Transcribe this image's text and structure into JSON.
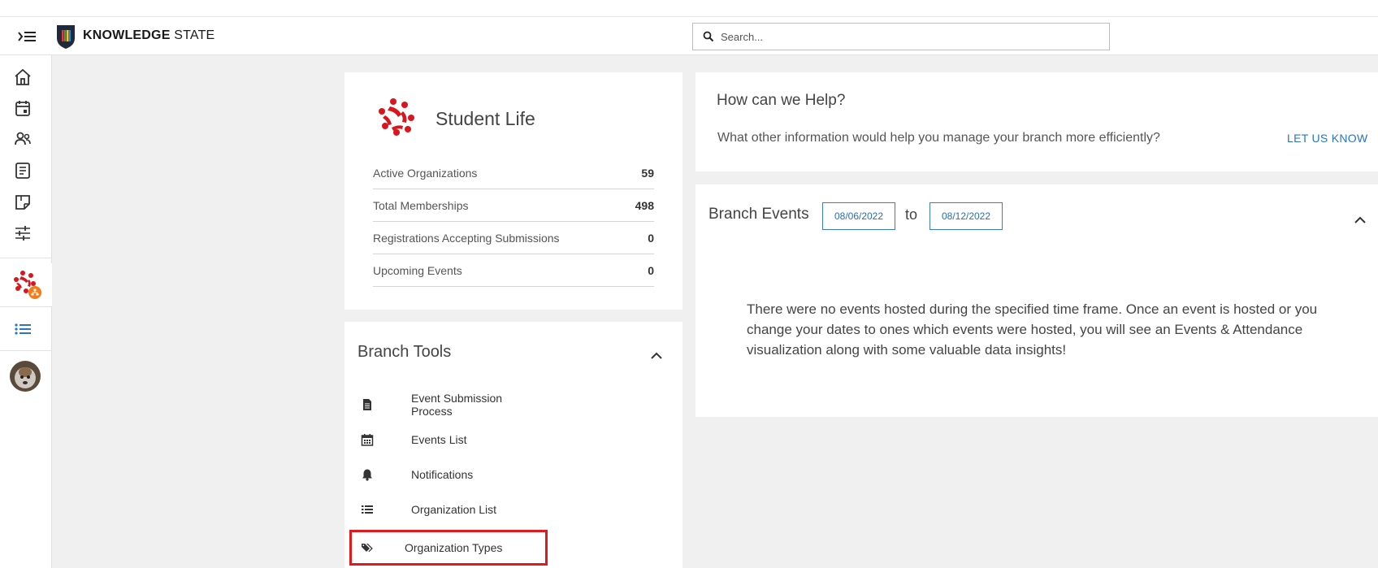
{
  "header": {
    "brand_bold": "KNOWLEDGE",
    "brand_light": "STATE",
    "search_placeholder": "Search..."
  },
  "sidebar": {
    "items": [
      {
        "icon": "home-icon"
      },
      {
        "icon": "calendar-icon"
      },
      {
        "icon": "people-icon"
      },
      {
        "icon": "document-icon"
      },
      {
        "icon": "form-icon"
      },
      {
        "icon": "sliders-icon"
      },
      {
        "icon": "branch-logo-icon"
      },
      {
        "icon": "list-icon"
      },
      {
        "icon": "avatar"
      }
    ],
    "accent_color": "#2a73c5",
    "badge_color": "#f07c1a"
  },
  "student_life": {
    "title": "Student Life",
    "stats": [
      {
        "label": "Active Organizations",
        "value": "59"
      },
      {
        "label": "Total Memberships",
        "value": "498"
      },
      {
        "label": "Registrations Accepting Submissions",
        "value": "0"
      },
      {
        "label": "Upcoming Events",
        "value": "0"
      }
    ],
    "logo_color": "#d9151d"
  },
  "branch_tools": {
    "title": "Branch Tools",
    "items": [
      {
        "label": "Event Submission Process",
        "icon": "file-icon"
      },
      {
        "label": "Events List",
        "icon": "calendar-icon"
      },
      {
        "label": "Notifications",
        "icon": "bell-icon"
      },
      {
        "label": "Organization List",
        "icon": "list-icon"
      },
      {
        "label": "Organization Types",
        "icon": "tags-icon",
        "highlighted": true
      }
    ],
    "highlight_color": "#e0191f"
  },
  "help": {
    "title": "How can we Help?",
    "text": "What other information would help you manage your branch more efficiently?",
    "link": "LET US KNOW"
  },
  "branch_events": {
    "title": "Branch Events",
    "start_date": "08/06/2022",
    "to_label": "to",
    "end_date": "08/12/2022",
    "message": "There were no events hosted during the specified time frame. Once an event is hosted or you change your dates to ones which events were hosted, you will see an Events & Attendance visualization along with some valuable data insights!"
  }
}
